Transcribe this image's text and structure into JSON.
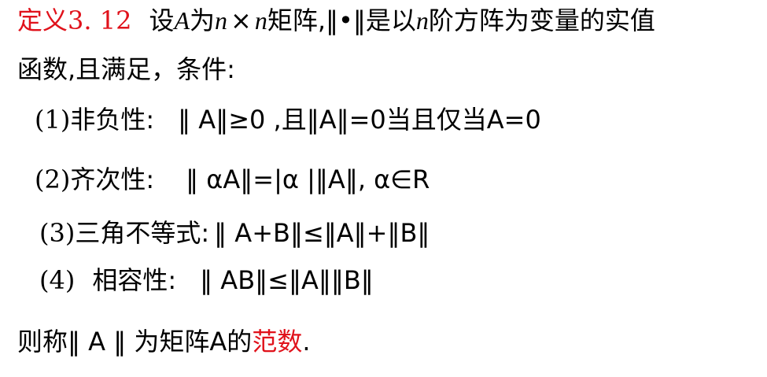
{
  "definition": {
    "label": "定义3. 12",
    "text_prefix": "设",
    "A": "A",
    "text_wei": "为",
    "n1": "n",
    "times": "×",
    "n2": "n",
    "text_matrix": "矩阵,",
    "norm_symbol": "‖•‖",
    "text_mid": "是以",
    "n3": "n",
    "text_end": "阶方阵为变量的实值",
    "line2": "函数,且满足，条件:"
  },
  "conditions": [
    {
      "num": "(1)",
      "name": "非负性:",
      "formula": "‖ A‖≥0 ,且‖A‖=0当且仅当A=0"
    },
    {
      "num": "(2)",
      "name": "齐次性:",
      "formula": "‖ αA‖=|α |‖A‖, α∈R"
    },
    {
      "num": "(3)",
      "name": "三角不等式:",
      "formula": "‖ A+B‖≤‖A‖+‖B‖"
    },
    {
      "num": "(4)",
      "name": "相容性:",
      "formula": "‖ AB‖≤‖A‖‖B‖"
    }
  ],
  "conclusion": {
    "prefix": "则称‖ A ‖ 为矩阵A的",
    "term": "范数",
    "suffix": "."
  },
  "colors": {
    "accent": "#e0121b",
    "text": "#000000"
  }
}
